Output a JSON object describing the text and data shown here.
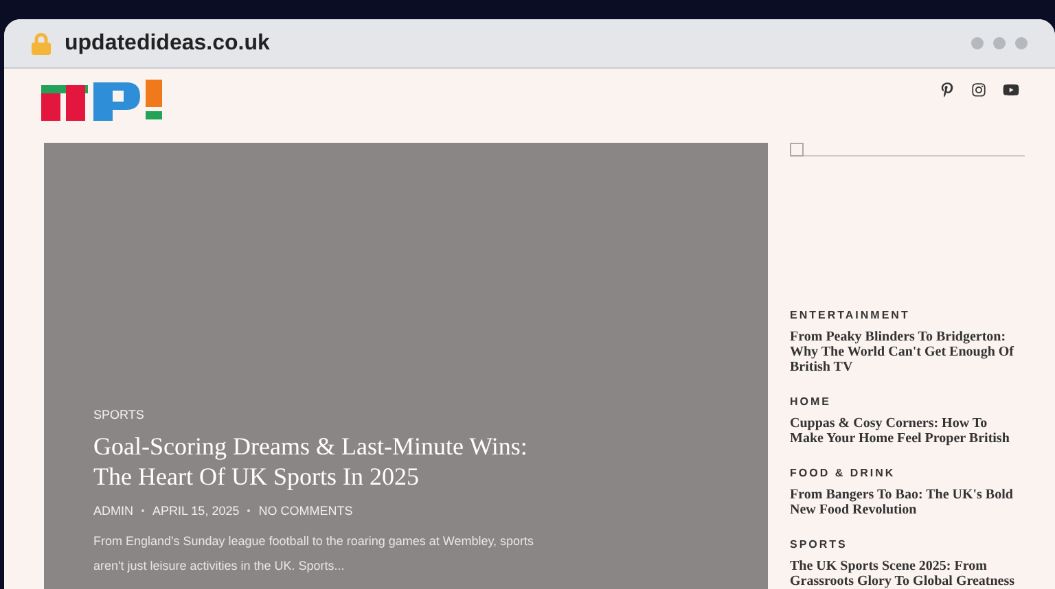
{
  "browser": {
    "url": "updatedideas.co.uk"
  },
  "hero": {
    "category": "SPORTS",
    "title": "Goal-Scoring Dreams & Last-Minute Wins: The Heart Of UK Sports In 2025",
    "author": "ADMIN",
    "date": "APRIL 15, 2025",
    "comments": "NO COMMENTS",
    "excerpt": "From England's Sunday league football to the roaring games at Wembley, sports aren't just leisure activities in the UK. Sports..."
  },
  "sidebar": {
    "posts": [
      {
        "category": "ENTERTAINMENT",
        "title": "From Peaky Blinders To Bridgerton: Why The World Can't Get Enough Of British TV"
      },
      {
        "category": "HOME",
        "title": "Cuppas & Cosy Corners: How To Make Your Home Feel Proper British"
      },
      {
        "category": "FOOD & DRINK",
        "title": "From Bangers To Bao: The UK's Bold New Food Revolution"
      },
      {
        "category": "SPORTS",
        "title": "The UK Sports Scene 2025: From Grassroots Glory To Global Greatness"
      }
    ]
  }
}
